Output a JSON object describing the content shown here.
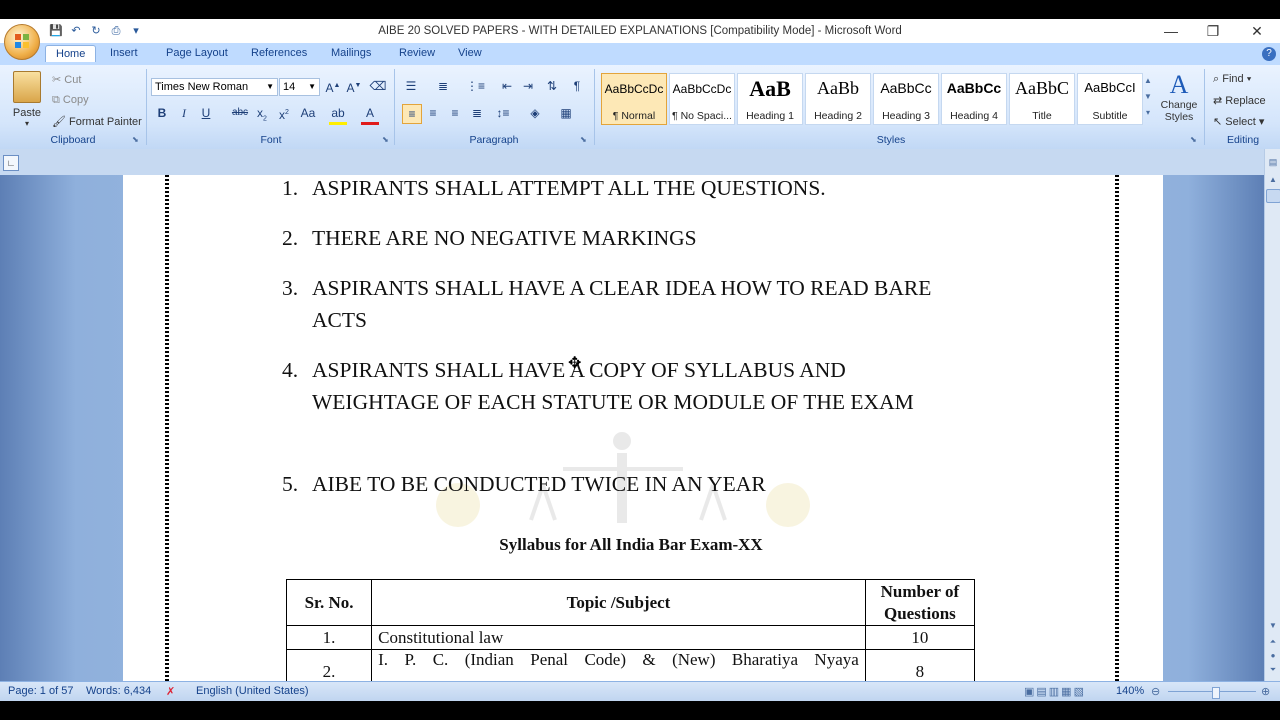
{
  "window": {
    "title": "AIBE 20 SOLVED PAPERS - WITH DETAILED EXPLANATIONS [Compatibility Mode] - Microsoft Word",
    "minimize": "—",
    "restore": "❐",
    "close": "✕"
  },
  "tabs": [
    "Home",
    "Insert",
    "Page Layout",
    "References",
    "Mailings",
    "Review",
    "View"
  ],
  "clipboard": {
    "label": "Clipboard",
    "paste": "Paste",
    "cut": "Cut",
    "copy": "Copy",
    "format_painter": "Format Painter"
  },
  "font": {
    "label": "Font",
    "family": "Times New Roman",
    "size": "14"
  },
  "paragraph": {
    "label": "Paragraph"
  },
  "styles": {
    "label": "Styles",
    "items": [
      {
        "preview": "AaBbCcDc",
        "name": "¶ Normal"
      },
      {
        "preview": "AaBbCcDc",
        "name": "¶ No Spaci..."
      },
      {
        "preview": "AaB",
        "name": "Heading 1"
      },
      {
        "preview": "AaBb",
        "name": "Heading 2"
      },
      {
        "preview": "AaBbCc",
        "name": "Heading 3"
      },
      {
        "preview": "AaBbCc",
        "name": "Heading 4"
      },
      {
        "preview": "AaBbC",
        "name": "Title"
      },
      {
        "preview": "AaBbCcI",
        "name": "Subtitle"
      }
    ],
    "change_styles": "Change Styles"
  },
  "editing": {
    "label": "Editing",
    "find": "Find",
    "replace": "Replace",
    "select": "Select"
  },
  "document": {
    "list": [
      {
        "num": "1.",
        "text": "ASPIRANTS SHALL ATTEMPT ALL THE QUESTIONS."
      },
      {
        "num": "2.",
        "text": "THERE ARE NO NEGATIVE MARKINGS"
      },
      {
        "num": "3.",
        "text": "ASPIRANTS SHALL HAVE A CLEAR IDEA HOW TO READ BARE ACTS"
      },
      {
        "num": "4.",
        "text": "ASPIRANTS SHALL HAVE A COPY OF SYLLABUS AND WEIGHTAGE OF EACH STATUTE OR MODULE OF THE EXAM"
      },
      {
        "num": "5.",
        "text": "AIBE TO BE CONDUCTED TWICE IN AN YEAR"
      }
    ],
    "syllabus_title": "Syllabus for All India Bar Exam-XX",
    "table": {
      "headers": [
        "Sr. No.",
        "Topic /Subject",
        "Number of Questions"
      ],
      "rows": [
        {
          "sr": "1.",
          "topic": "Constitutional law",
          "count": "10"
        },
        {
          "sr": "2.",
          "topic": "I. P. C. (Indian Penal Code) & (New) Bharatiya Nyaya",
          "count": "8"
        }
      ]
    }
  },
  "status": {
    "page": "Page: 1 of 57",
    "words": "Words: 6,434",
    "language": "English (United States)",
    "zoom": "140%"
  }
}
